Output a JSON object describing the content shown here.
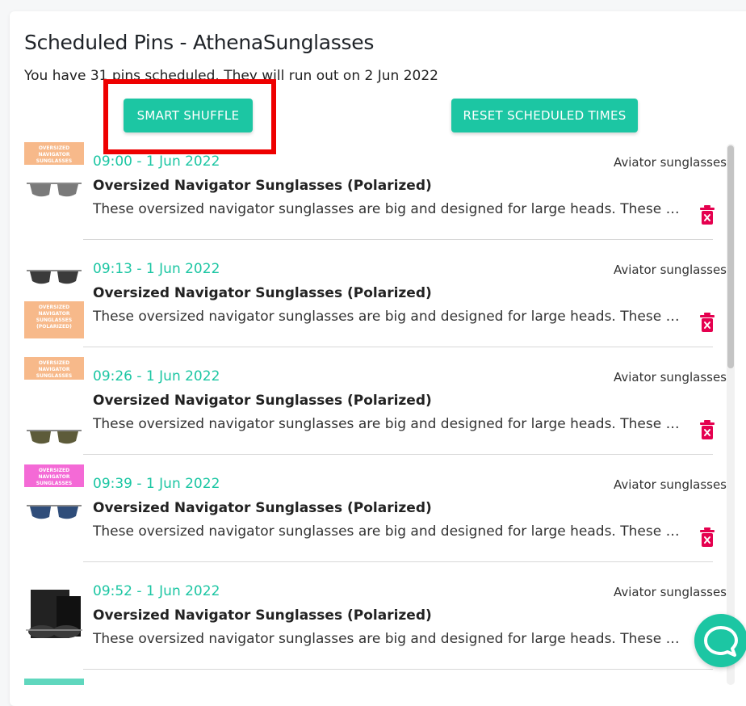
{
  "page": {
    "title": "Scheduled Pins - AthenaSunglasses",
    "subtitle": "You have 31 pins scheduled. They will run out on 2 Jun 2022"
  },
  "buttons": {
    "smart_shuffle": "SMART SHUFFLE",
    "reset_times": "RESET SCHEDULED TIMES"
  },
  "pins": [
    {
      "time": "09:00 - 1 Jun 2022",
      "board": "Aviator sunglasses",
      "title": "Oversized Navigator Sunglasses (Polarized)",
      "description": "These oversized navigator sunglasses are big and designed for large heads. These XL navigator sunglasses",
      "thumb_text": "OVERSIZED NAVIGATOR SUNGLASSES (POLARIZED)",
      "thumb_color": "#f7b98a",
      "lens_color": "#7a7a7a"
    },
    {
      "time": "09:13 - 1 Jun 2022",
      "board": "Aviator sunglasses",
      "title": "Oversized Navigator Sunglasses (Polarized)",
      "description": "These oversized navigator sunglasses are big and designed for large heads. These XL navigator sunglasses",
      "thumb_text": "OVERSIZED NAVIGATOR SUNGLASSES (POLARIZED)",
      "thumb_color": "#f7b98a",
      "lens_color": "#3b3b3b"
    },
    {
      "time": "09:26 - 1 Jun 2022",
      "board": "Aviator sunglasses",
      "title": "Oversized Navigator Sunglasses (Polarized)",
      "description": "These oversized navigator sunglasses are big and designed for large heads. These XL navigator sunglasses",
      "thumb_text": "OVERSIZED NAVIGATOR SUNGLASSES (POLARIZED)",
      "thumb_color": "#f7b98a",
      "lens_color": "#5d5b3a"
    },
    {
      "time": "09:39 - 1 Jun 2022",
      "board": "Aviator sunglasses",
      "title": "Oversized Navigator Sunglasses (Polarized)",
      "description": "These oversized navigator sunglasses are big and designed for large heads. These XL navigator sunglasses",
      "thumb_text": "OVERSIZED NAVIGATOR SUNGLASSES (POLARIZED)",
      "thumb_color": "#f46ad6",
      "lens_color": "#2f4d7a"
    },
    {
      "time": "09:52 - 1 Jun 2022",
      "board": "Aviator sunglasses",
      "title": "Oversized Navigator Sunglasses (Polarized)",
      "description": "These oversized navigator sunglasses are big and designed for large heads. These XL navigator sunglasses",
      "thumb_text": "",
      "thumb_color": "#222222",
      "lens_color": "#222222"
    }
  ],
  "icons": {
    "trash": "trash-icon",
    "chat": "chat-bubble-icon"
  },
  "colors": {
    "accent": "#1cc6a3",
    "danger": "#e5004f",
    "highlight": "#ee0000"
  }
}
